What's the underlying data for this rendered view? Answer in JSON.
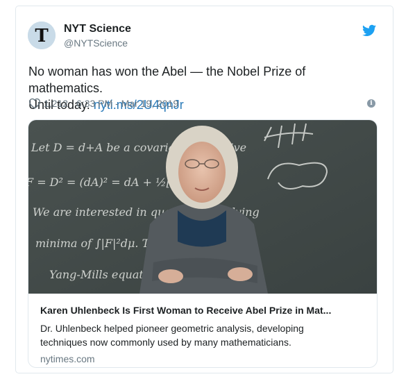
{
  "account": {
    "name": "NYT Science",
    "handle": "@NYTScience",
    "avatar_icon": "nyt-logo-icon",
    "platform_icon": "twitter-bird-icon",
    "brand_color": "#1da1f2"
  },
  "tweet": {
    "text_line1": "No woman has won the Abel — the Nobel Prize of mathematics.",
    "text_line2": "Until today.",
    "link": "nyti.ms/2U4qnJr",
    "likes": "1,212",
    "timestamp": "6:33 PM - Mar 19, 2019",
    "info_icon": "info-icon",
    "heart_icon": "heart-icon"
  },
  "card": {
    "image_alt": "Karen Uhlenbeck in front of a chalkboard",
    "chalk_lines": [
      "Let D = d+A be a covariant derivative",
      "F = D² = (dA)² = dA + ½[A,A] belts",
      "We are interested in questions involving",
      "minima of ∫|F|²dμ. Those are",
      "Yang-Mills equations."
    ],
    "title": "Karen Uhlenbeck Is First Woman to Receive Abel Prize in Mat...",
    "description_line1": "Dr. Uhlenbeck helped pioneer geometric analysis, developing",
    "description_line2": "techniques now commonly used by many mathematicians.",
    "domain": "nytimes.com"
  }
}
